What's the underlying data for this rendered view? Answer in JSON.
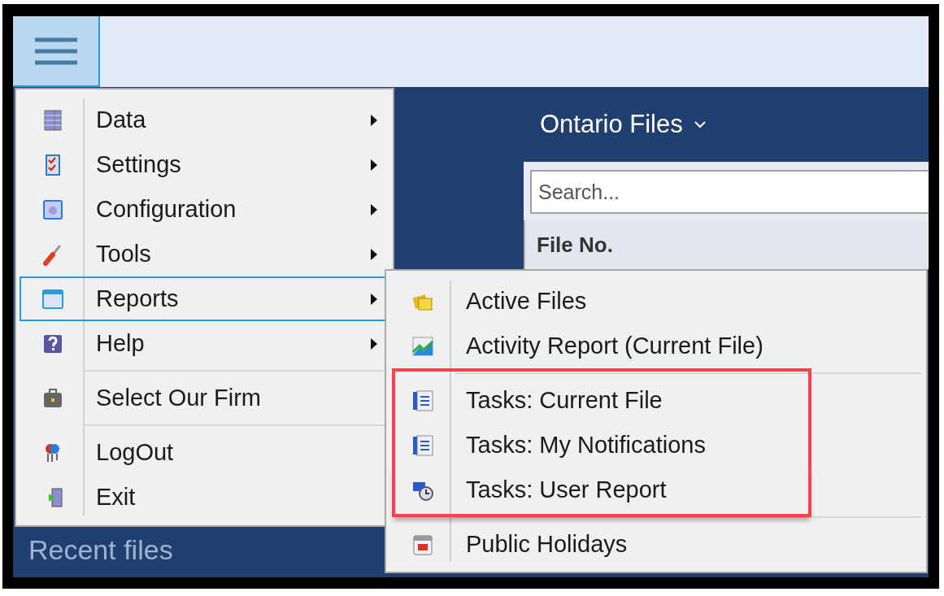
{
  "menu_button": {
    "pressed": true
  },
  "panel": {
    "title": "Ontario Files",
    "search": {
      "placeholder": "Search..."
    },
    "table": {
      "columns": [
        "File No."
      ]
    }
  },
  "recent_files": {
    "label": "Recent files"
  },
  "main_menu": {
    "items": [
      {
        "label": "Data",
        "submenu": true,
        "selected": false,
        "separator_before": false
      },
      {
        "label": "Settings",
        "submenu": true,
        "selected": false,
        "separator_before": false
      },
      {
        "label": "Configuration",
        "submenu": true,
        "selected": false,
        "separator_before": false
      },
      {
        "label": "Tools",
        "submenu": true,
        "selected": false,
        "separator_before": false
      },
      {
        "label": "Reports",
        "submenu": true,
        "selected": true,
        "separator_before": false
      },
      {
        "label": "Help",
        "submenu": true,
        "selected": false,
        "separator_before": false
      },
      {
        "label": "Select Our Firm",
        "submenu": false,
        "selected": false,
        "separator_before": true
      },
      {
        "label": "LogOut",
        "submenu": false,
        "selected": false,
        "separator_before": true
      },
      {
        "label": "Exit",
        "submenu": false,
        "selected": false,
        "separator_before": false
      }
    ]
  },
  "reports_menu": {
    "items": [
      {
        "label": "Active Files",
        "separator_before": false,
        "highlighted": false
      },
      {
        "label": "Activity Report (Current File)",
        "separator_before": false,
        "highlighted": false
      },
      {
        "label": "Tasks: Current File",
        "separator_before": true,
        "highlighted": true
      },
      {
        "label": "Tasks: My Notifications",
        "separator_before": false,
        "highlighted": true
      },
      {
        "label": "Tasks: User Report",
        "separator_before": false,
        "highlighted": true
      },
      {
        "label": "Public Holidays",
        "separator_before": true,
        "highlighted": false
      }
    ]
  }
}
